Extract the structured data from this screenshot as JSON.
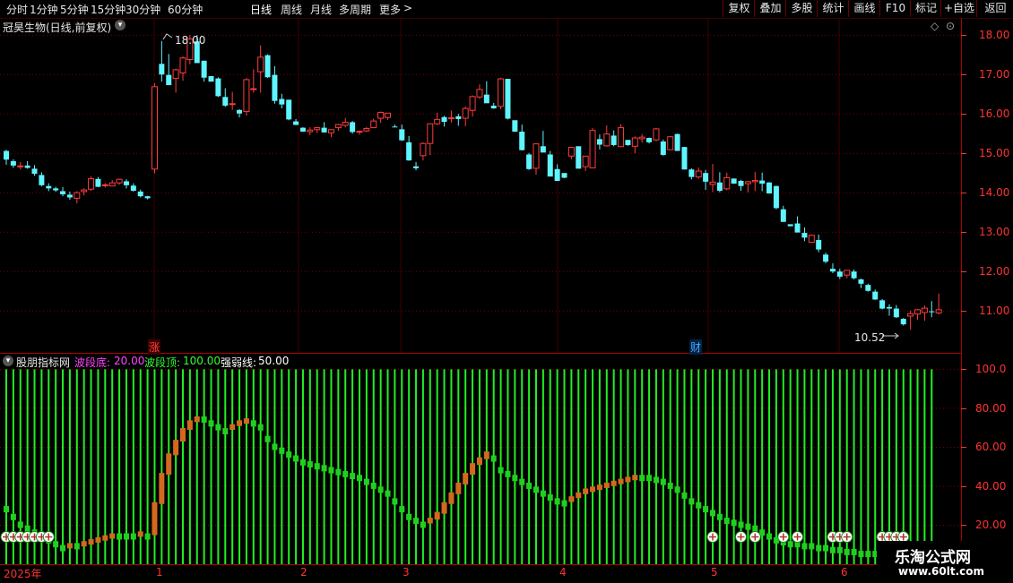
{
  "toolbar": {
    "timeframes": [
      "分时",
      "1分钟",
      "5分钟",
      "15分钟",
      "30分钟",
      "60分钟",
      "日线",
      "周线",
      "月线",
      "多周期",
      "更多"
    ],
    "active_timeframe": "日线",
    "more_arrow": ">",
    "buttons": [
      "复权",
      "叠加",
      "多股",
      "统计",
      "画线",
      "F10",
      "标记",
      "+自选",
      "返回"
    ]
  },
  "main_chart": {
    "title": "冠昊生物(日线,前复权)",
    "high_marker": "18.00",
    "low_marker": "10.52",
    "y_ticks": [
      "18.00",
      "17.00",
      "16.00",
      "15.00",
      "14.00",
      "13.00",
      "12.00",
      "11.00"
    ],
    "badges": [
      {
        "text": "涨",
        "color": "#ff4040"
      },
      {
        "text": "财",
        "color": "#4da6ff"
      }
    ]
  },
  "indicator": {
    "name": "股朋指标网",
    "params": [
      {
        "label": "波段底:",
        "value": "20.00",
        "color": "#ff44ff"
      },
      {
        "label": "波段顶:",
        "value": "100.00",
        "color": "#33ff33"
      },
      {
        "label": "强弱线:",
        "value": "50.00",
        "color": "#ffffff"
      }
    ],
    "y_ticks": [
      "100.0",
      "80.00",
      "60.00",
      "40.00",
      "20.00"
    ]
  },
  "x_axis": {
    "labels": [
      "2025年",
      "1",
      "2",
      "3",
      "4",
      "5",
      "6"
    ]
  },
  "watermark": {
    "line1": "乐淘公式网",
    "line2": "www.60lt.com"
  },
  "colors": {
    "up": "#ff3c3c",
    "down": "#5ff5ff",
    "grid": "#7a0000",
    "axis": "#ff3333",
    "bars": "#22ee22"
  },
  "chart_data": {
    "type": "candlestick",
    "y_range": [
      10.3,
      18.3
    ],
    "ohlc": [
      [
        15.06,
        15.09,
        14.71,
        14.84
      ],
      [
        14.8,
        14.85,
        14.63,
        14.69
      ],
      [
        14.67,
        14.78,
        14.59,
        14.68
      ],
      [
        14.69,
        14.8,
        14.61,
        14.63
      ],
      [
        14.61,
        14.7,
        14.43,
        14.48
      ],
      [
        14.45,
        14.52,
        14.16,
        14.19
      ],
      [
        14.17,
        14.24,
        14.04,
        14.11
      ],
      [
        14.11,
        14.15,
        14.02,
        14.06
      ],
      [
        14.04,
        14.14,
        13.91,
        13.96
      ],
      [
        13.95,
        14.03,
        13.82,
        13.88
      ],
      [
        13.86,
        14.04,
        13.73,
        14.0
      ],
      [
        14.03,
        14.11,
        13.93,
        14.07
      ],
      [
        14.09,
        14.42,
        14.05,
        14.36
      ],
      [
        14.35,
        14.4,
        14.14,
        14.15
      ],
      [
        14.19,
        14.24,
        14.13,
        14.2
      ],
      [
        14.17,
        14.32,
        14.17,
        14.25
      ],
      [
        14.25,
        14.36,
        14.2,
        14.34
      ],
      [
        14.29,
        14.34,
        14.11,
        14.19
      ],
      [
        14.18,
        14.24,
        14.03,
        14.05
      ],
      [
        14.03,
        14.08,
        13.88,
        13.91
      ],
      [
        13.91,
        13.92,
        13.83,
        13.86
      ],
      [
        14.6,
        16.78,
        14.49,
        16.69
      ],
      [
        17.27,
        17.85,
        16.82,
        17.0
      ],
      [
        16.99,
        17.52,
        16.85,
        16.73
      ],
      [
        16.9,
        17.15,
        16.54,
        17.12
      ],
      [
        17.04,
        17.46,
        16.84,
        17.42
      ],
      [
        17.38,
        18.0,
        17.26,
        17.9
      ],
      [
        17.84,
        18.0,
        17.55,
        17.29
      ],
      [
        17.35,
        17.35,
        16.82,
        16.92
      ],
      [
        16.96,
        16.89,
        16.82,
        16.82
      ],
      [
        16.9,
        16.93,
        16.43,
        16.45
      ],
      [
        16.43,
        16.65,
        16.18,
        16.21
      ],
      [
        16.25,
        16.56,
        16.1,
        16.26
      ],
      [
        16.1,
        16.12,
        15.91,
        16.01
      ],
      [
        16.06,
        16.91,
        15.96,
        16.87
      ],
      [
        16.62,
        17.13,
        16.54,
        16.64
      ],
      [
        17.07,
        17.74,
        16.54,
        17.44
      ],
      [
        17.49,
        17.51,
        16.91,
        16.93
      ],
      [
        16.99,
        17.21,
        16.26,
        16.33
      ],
      [
        16.38,
        16.51,
        16.14,
        16.24
      ],
      [
        16.36,
        16.36,
        15.84,
        15.86
      ],
      [
        15.81,
        15.87,
        15.72,
        15.72
      ],
      [
        15.65,
        15.66,
        15.56,
        15.55
      ],
      [
        15.55,
        15.66,
        15.46,
        15.59
      ],
      [
        15.6,
        15.67,
        15.51,
        15.65
      ],
      [
        15.65,
        15.79,
        15.53,
        15.53
      ],
      [
        15.52,
        15.61,
        15.41,
        15.6
      ],
      [
        15.65,
        15.75,
        15.57,
        15.73
      ],
      [
        15.71,
        15.9,
        15.66,
        15.79
      ],
      [
        15.79,
        15.82,
        15.5,
        15.54
      ],
      [
        15.55,
        15.58,
        15.47,
        15.56
      ],
      [
        15.57,
        15.67,
        15.54,
        15.63
      ],
      [
        15.65,
        15.88,
        15.67,
        15.82
      ],
      [
        15.89,
        16.06,
        15.77,
        16.04
      ],
      [
        15.91,
        16.02,
        15.85,
        16.02
      ],
      [
        15.68,
        15.73,
        15.66,
        15.67
      ],
      [
        15.61,
        15.73,
        15.31,
        15.33
      ],
      [
        15.28,
        15.44,
        14.81,
        14.82
      ],
      [
        14.67,
        14.78,
        14.57,
        14.62
      ],
      [
        14.94,
        15.28,
        14.82,
        15.25
      ],
      [
        15.25,
        15.76,
        14.96,
        15.75
      ],
      [
        15.75,
        16.03,
        15.72,
        15.86
      ],
      [
        15.92,
        15.95,
        15.68,
        15.8
      ],
      [
        15.88,
        16.09,
        15.78,
        15.9
      ],
      [
        15.94,
        16.0,
        15.7,
        15.87
      ],
      [
        15.89,
        16.19,
        15.69,
        16.14
      ],
      [
        16.09,
        16.47,
        15.93,
        16.44
      ],
      [
        16.43,
        16.75,
        16.38,
        16.62
      ],
      [
        16.49,
        16.83,
        16.39,
        16.27
      ],
      [
        16.21,
        16.28,
        16.13,
        16.14
      ],
      [
        16.19,
        16.92,
        16.12,
        16.89
      ],
      [
        16.89,
        16.75,
        15.86,
        15.88
      ],
      [
        15.84,
        15.76,
        15.6,
        15.55
      ],
      [
        15.55,
        15.73,
        15.07,
        15.08
      ],
      [
        14.97,
        15.01,
        14.58,
        14.6
      ],
      [
        14.62,
        15.25,
        14.46,
        15.24
      ],
      [
        15.18,
        15.57,
        15.04,
        15.02
      ],
      [
        14.97,
        15.06,
        14.42,
        14.41
      ],
      [
        14.6,
        14.72,
        14.38,
        14.3
      ],
      [
        14.5,
        14.47,
        14.37,
        14.38
      ],
      [
        14.93,
        15.16,
        14.85,
        15.15
      ],
      [
        15.18,
        15.01,
        14.82,
        14.61
      ],
      [
        14.66,
        14.87,
        14.55,
        14.93
      ],
      [
        14.63,
        15.64,
        14.62,
        15.58
      ],
      [
        15.36,
        15.48,
        15.1,
        15.22
      ],
      [
        15.19,
        15.71,
        15.17,
        15.49
      ],
      [
        15.45,
        15.58,
        15.18,
        15.21
      ],
      [
        15.17,
        15.74,
        15.33,
        15.65
      ],
      [
        15.34,
        15.34,
        15.19,
        15.21
      ],
      [
        15.18,
        15.43,
        15.0,
        15.39
      ],
      [
        15.37,
        15.49,
        15.27,
        15.41
      ],
      [
        15.39,
        15.4,
        15.25,
        15.28
      ],
      [
        15.34,
        15.64,
        15.31,
        15.62
      ],
      [
        15.3,
        15.35,
        14.94,
        14.96
      ],
      [
        15.09,
        15.44,
        15.09,
        15.42
      ],
      [
        15.49,
        15.5,
        15.07,
        15.06
      ],
      [
        15.16,
        15.16,
        14.59,
        14.59
      ],
      [
        14.59,
        14.62,
        14.34,
        14.4
      ],
      [
        14.4,
        14.64,
        14.35,
        14.55
      ],
      [
        14.5,
        14.58,
        14.07,
        14.28
      ],
      [
        14.21,
        14.73,
        14.02,
        14.27
      ],
      [
        14.26,
        14.52,
        14.01,
        14.05
      ],
      [
        14.1,
        14.51,
        14.06,
        14.38
      ],
      [
        14.36,
        14.36,
        14.3,
        14.23
      ],
      [
        14.3,
        14.33,
        14.05,
        14.17
      ],
      [
        14.23,
        14.3,
        14.01,
        14.28
      ],
      [
        14.28,
        14.53,
        14.04,
        14.31
      ],
      [
        14.31,
        14.51,
        14.04,
        14.23
      ],
      [
        14.26,
        14.27,
        13.98,
        13.98
      ],
      [
        14.17,
        14.18,
        13.58,
        13.61
      ],
      [
        13.58,
        13.67,
        13.34,
        13.26
      ],
      [
        13.2,
        13.2,
        13.15,
        13.15
      ],
      [
        13.22,
        13.4,
        13.08,
        12.99
      ],
      [
        12.98,
        13.12,
        12.77,
        12.86
      ],
      [
        12.74,
        12.94,
        12.77,
        12.92
      ],
      [
        12.8,
        12.94,
        12.49,
        12.56
      ],
      [
        12.43,
        12.48,
        12.21,
        12.25
      ],
      [
        12.07,
        12.21,
        11.96,
        12.0
      ],
      [
        12.0,
        12.07,
        11.81,
        11.87
      ],
      [
        11.91,
        12.03,
        11.83,
        12.03
      ],
      [
        12.0,
        12.05,
        11.8,
        11.83
      ],
      [
        11.8,
        11.82,
        11.58,
        11.69
      ],
      [
        11.66,
        11.69,
        11.49,
        11.51
      ],
      [
        11.49,
        11.54,
        11.28,
        11.29
      ],
      [
        11.27,
        11.3,
        11.04,
        11.06
      ],
      [
        11.1,
        11.17,
        10.88,
        11.06
      ],
      [
        11.06,
        11.15,
        10.82,
        10.84
      ],
      [
        10.8,
        10.82,
        10.63,
        10.66
      ],
      [
        10.87,
        11.01,
        10.52,
        10.93
      ],
      [
        10.92,
        11.05,
        10.77,
        11.03
      ],
      [
        10.96,
        11.14,
        10.75,
        11.07
      ],
      [
        10.99,
        11.25,
        10.84,
        10.97
      ],
      [
        10.95,
        11.44,
        10.91,
        11.03
      ]
    ],
    "indicator_range": [
      0,
      108
    ],
    "indicator": [
      28,
      24,
      20,
      18,
      16,
      14,
      12,
      10,
      8,
      9,
      9,
      10,
      11,
      12,
      13,
      14,
      14,
      14,
      14,
      15,
      14,
      30,
      45,
      55,
      62,
      68,
      72,
      74,
      74,
      72,
      70,
      68,
      70,
      72,
      73,
      72,
      70,
      64,
      60,
      58,
      56,
      54,
      52,
      51,
      50,
      49,
      48,
      47,
      46,
      45,
      44,
      42,
      40,
      38,
      36,
      32,
      28,
      24,
      22,
      20,
      22,
      25,
      30,
      35,
      40,
      45,
      50,
      53,
      56,
      54,
      48,
      46,
      44,
      42,
      40,
      38,
      36,
      34,
      32,
      31,
      33,
      35,
      37,
      38,
      39,
      40,
      41,
      42,
      43,
      44,
      44,
      44,
      43,
      42,
      40,
      38,
      35,
      32,
      30,
      28,
      26,
      24,
      22,
      21,
      20,
      19,
      18,
      16,
      14,
      12,
      11,
      10,
      10,
      9,
      9,
      8,
      8,
      7,
      7,
      6,
      6,
      5,
      5,
      5,
      5,
      5,
      5,
      5,
      5,
      5,
      5,
      5
    ],
    "plus_markers": [
      0,
      1,
      2,
      3,
      4,
      5,
      6,
      100,
      104,
      106,
      110,
      112,
      117,
      118,
      119,
      124,
      125,
      126,
      127
    ],
    "thresholds": {
      "low": 20,
      "high": 100,
      "mid": 50
    }
  }
}
